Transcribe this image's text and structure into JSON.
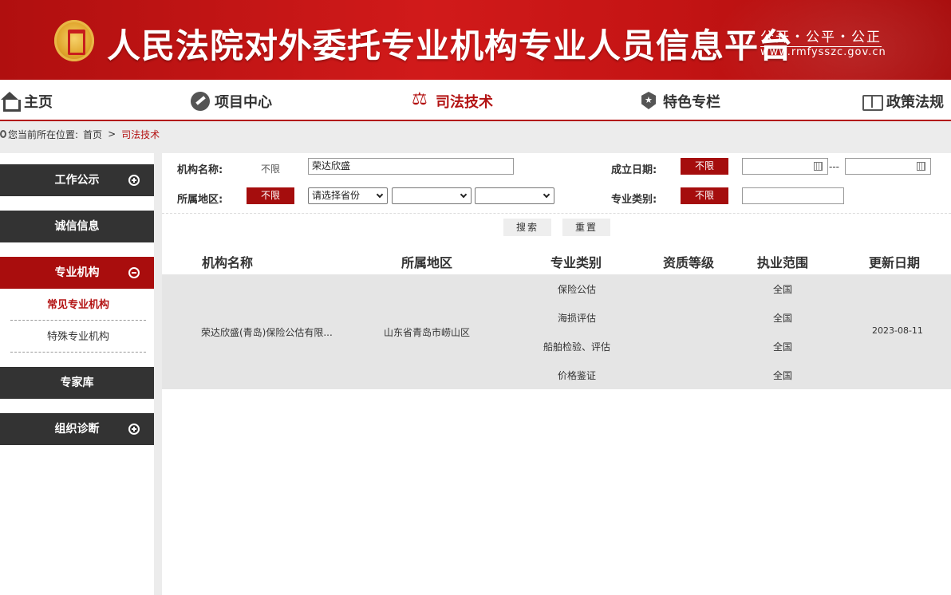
{
  "header": {
    "site_title": "人民法院对外委托专业机构专业人员信息平台",
    "slogan": "公开・公平・公正",
    "url": "www.rmfysszc.gov.cn"
  },
  "nav": {
    "items": [
      {
        "label": "主页",
        "icon": "home-icon"
      },
      {
        "label": "项目中心",
        "icon": "gavel-icon"
      },
      {
        "label": "司法技术",
        "icon": "scale-icon",
        "active": true
      },
      {
        "label": "特色专栏",
        "icon": "badge-star-icon"
      },
      {
        "label": "政策法规",
        "icon": "book-icon"
      }
    ]
  },
  "breadcrumb": {
    "prefix": "您当前所在位置:",
    "home": "首页",
    "separator": ">",
    "current": "司法技术"
  },
  "sidebar": {
    "items": [
      {
        "label": "工作公示",
        "toggle": "plus"
      },
      {
        "label": "诚信信息"
      },
      {
        "label": "专业机构",
        "toggle": "minus",
        "active": true
      },
      {
        "label": "专家库"
      },
      {
        "label": "组织诊断",
        "toggle": "plus"
      }
    ],
    "sub_items": [
      {
        "label": "常见专业机构",
        "active": true
      },
      {
        "label": "特殊专业机构"
      }
    ]
  },
  "filters": {
    "name_label": "机构名称:",
    "name_unlimited": "不限",
    "name_value": "荣达欣盛",
    "date_label": "成立日期:",
    "date_unlimited": "不限",
    "date_separator": "---",
    "date_from": "",
    "date_to": "",
    "region_label": "所属地区:",
    "region_unlimited": "不限",
    "province_select": "请选择省份",
    "city_select": "",
    "district_select": "",
    "category_label": "专业类别:",
    "category_unlimited": "不限",
    "category_value": ""
  },
  "buttons": {
    "search": "搜索",
    "reset": "重置"
  },
  "table": {
    "headers": [
      "机构名称",
      "所属地区",
      "专业类别",
      "资质等级",
      "执业范围",
      "更新日期"
    ],
    "rows": [
      {
        "name": "荣达欣盛(青岛)保险公估有限...",
        "region": "山东省青岛市崂山区",
        "categories": [
          "保险公估",
          "海损评估",
          "船舶检验、评估",
          "价格鉴证"
        ],
        "qualification": "",
        "scopes": [
          "全国",
          "全国",
          "全国",
          "全国"
        ],
        "updated": "2023-08-11"
      }
    ]
  }
}
